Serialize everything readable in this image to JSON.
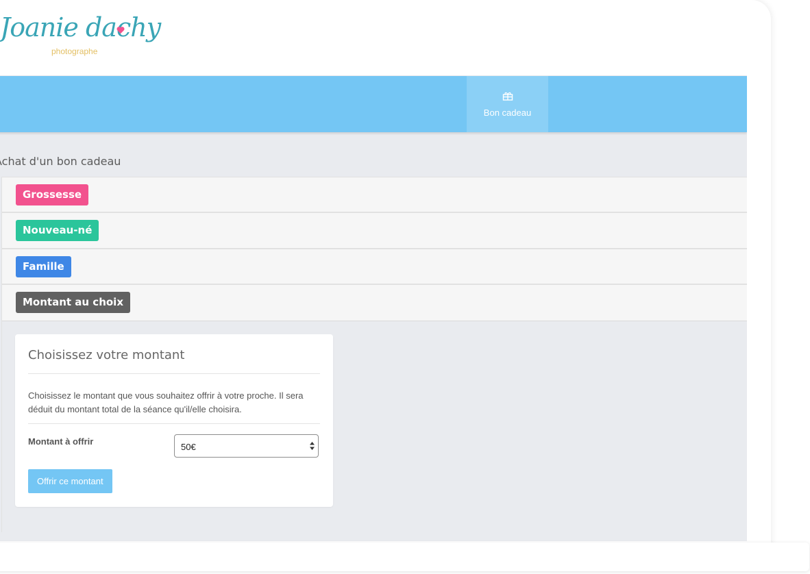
{
  "logo": {
    "name": "Joanie dachy",
    "sub": "photographe"
  },
  "nav": {
    "items": [
      {
        "label": "Bon cadeau",
        "icon": "gift-icon"
      }
    ]
  },
  "page": {
    "title": "Achat d'un bon cadeau"
  },
  "categories": [
    {
      "label": "Grossesse",
      "color": "#f2528e"
    },
    {
      "label": "Nouveau-né",
      "color": "#2bc59b"
    },
    {
      "label": "Famille",
      "color": "#3f87e6"
    },
    {
      "label": "Montant au choix",
      "color": "#616161"
    }
  ],
  "card": {
    "title": "Choisissez votre montant",
    "description": "Choisissez le montant que vous souhaitez offrir à votre proche. Il sera déduit du montant total de la séance qu'il/elle choisira.",
    "field_label": "Montant à offrir",
    "select_value": "50€",
    "button_label": "Offrir ce montant"
  },
  "colors": {
    "navbar": "#74c6f4",
    "accent": "#74c6f4"
  }
}
